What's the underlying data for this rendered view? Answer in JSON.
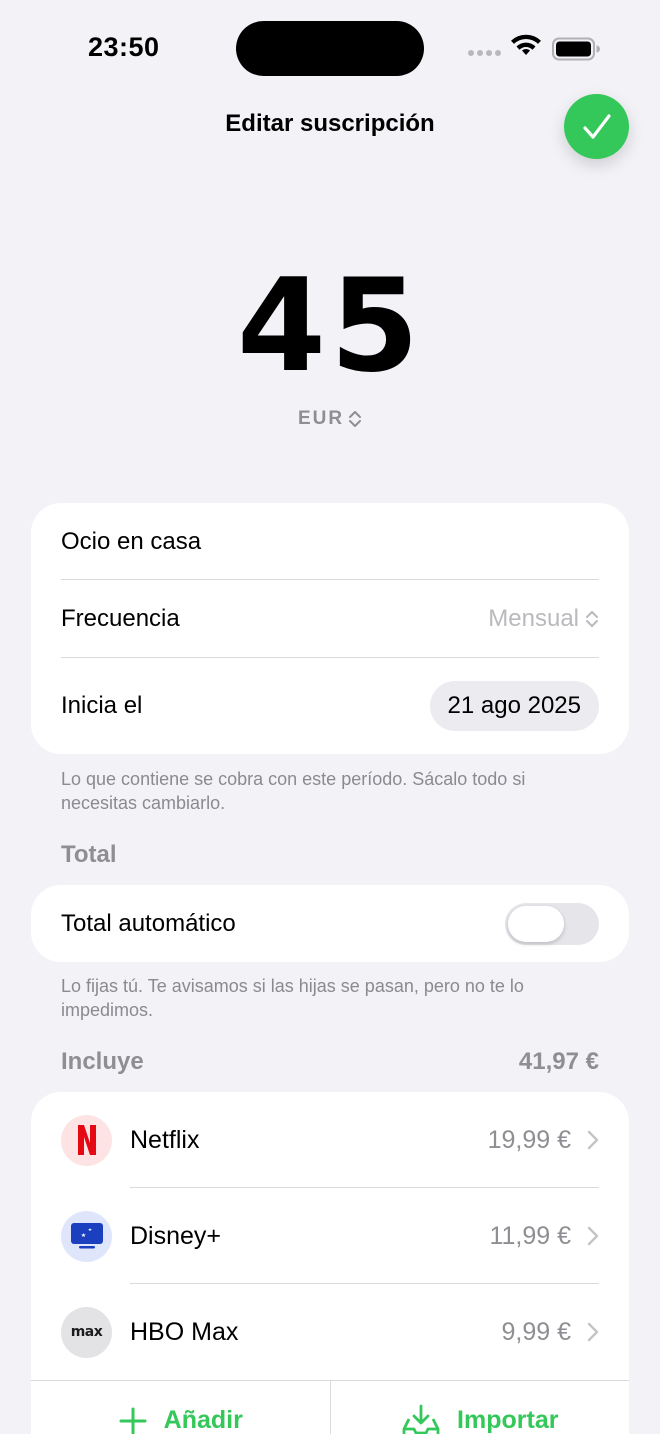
{
  "status_bar": {
    "time": "23:50"
  },
  "nav": {
    "title": "Editar suscripción"
  },
  "amount": {
    "value": "45",
    "currency": "EUR"
  },
  "details": {
    "name": "Ocio en casa",
    "frequency_label": "Frecuencia",
    "frequency_value": "Mensual",
    "start_label": "Inicia el",
    "start_value": "21 ago 2025",
    "footnote": "Lo que contiene se cobra con este período. Sácalo todo si necesitas cambiarlo."
  },
  "total": {
    "section_title": "Total",
    "auto_label": "Total automático",
    "auto_enabled": false,
    "footnote": "Lo fijas tú. Te avisamos si las hijas se pasan, pero no te lo impedimos."
  },
  "includes": {
    "section_title": "Incluye",
    "sum": "41,97 €",
    "items": [
      {
        "name": "Netflix",
        "price": "19,99 €",
        "icon": "netflix-logo"
      },
      {
        "name": "Disney+",
        "price": "11,99 €",
        "icon": "disney-plus-logo"
      },
      {
        "name": "HBO Max",
        "price": "9,99 €",
        "icon": "max-logo",
        "logo_text": "max"
      }
    ],
    "add_label": "Añadir",
    "import_label": "Importar"
  },
  "colors": {
    "accent": "#34c759",
    "background": "#f2f2f7",
    "netflix": "#e50914",
    "disney": "#1a3fbf"
  }
}
